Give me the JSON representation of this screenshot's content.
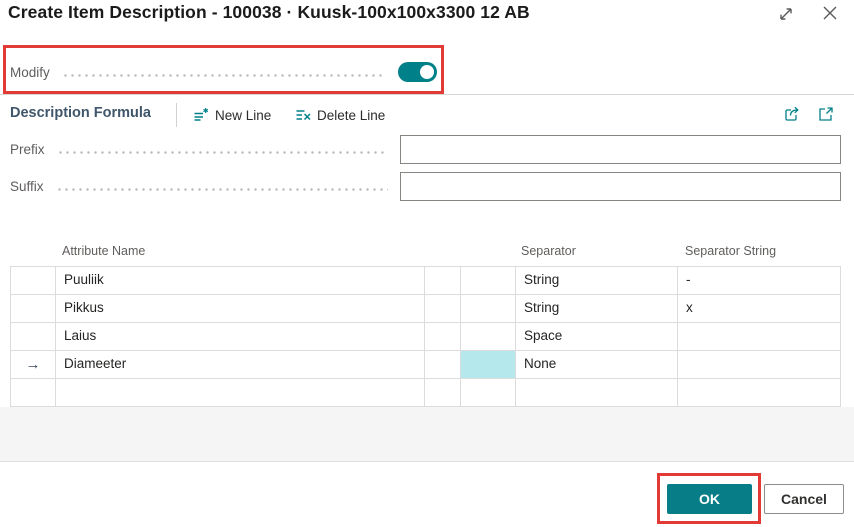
{
  "dialog": {
    "title": "Create Item Description - 100038 · Kuusk-100x100x3300 12 AB"
  },
  "modify": {
    "label": "Modify",
    "state": "on"
  },
  "toolbar": {
    "section_title": "Description Formula",
    "new_line_label": "New Line",
    "delete_line_label": "Delete Line"
  },
  "fields": {
    "prefix": {
      "label": "Prefix",
      "value": ""
    },
    "suffix": {
      "label": "Suffix",
      "value": ""
    }
  },
  "table": {
    "columns": {
      "attribute": "Attribute Name",
      "separator": "Separator",
      "separator_string": "Separator String"
    },
    "rows": [
      {
        "attribute_name": "Puuliik",
        "separator": "String",
        "separator_string": "-",
        "current": false,
        "highlighted_cell": false
      },
      {
        "attribute_name": "Pikkus",
        "separator": "String",
        "separator_string": "x",
        "current": false,
        "highlighted_cell": false
      },
      {
        "attribute_name": "Laius",
        "separator": "Space",
        "separator_string": "",
        "current": false,
        "highlighted_cell": false
      },
      {
        "attribute_name": "Diameeter",
        "separator": "None",
        "separator_string": "",
        "current": true,
        "highlighted_cell": true
      },
      {
        "attribute_name": "",
        "separator": "",
        "separator_string": "",
        "current": false,
        "highlighted_cell": false
      }
    ],
    "current_row_marker": "→"
  },
  "footer": {
    "ok_label": "OK",
    "cancel_label": "Cancel"
  },
  "annotations": {
    "highlight_color": "#e23b35",
    "highlighted_elements": [
      "modify-toggle-row",
      "ok-button"
    ]
  },
  "colors": {
    "accent_teal": "#008089",
    "selected_cell": "#b5e8ec",
    "label_gray": "#605e5c",
    "section_header": "#3f566b"
  }
}
